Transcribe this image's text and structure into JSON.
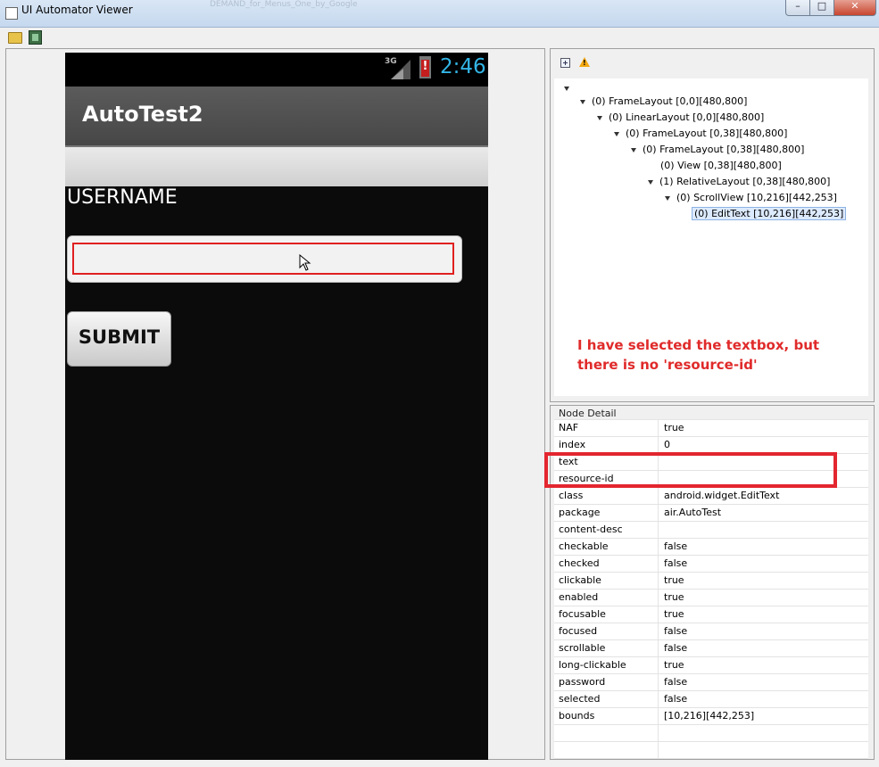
{
  "window": {
    "title": "UI Automator Viewer",
    "background_tab_text": "DEMAND_for_Menus_One_by_Google"
  },
  "toolbar": {
    "icons": [
      "folder-open-icon",
      "device-screenshot-icon"
    ]
  },
  "device": {
    "network_label": "3G",
    "battery_alert": "!",
    "clock": "2:46",
    "app_title": "AutoTest2",
    "username_label": "USERNAME",
    "submit_label": "SUBMIT"
  },
  "hierarchy": {
    "nodes": [
      {
        "label": "(0) FrameLayout [0,0][480,800]",
        "depth": 0
      },
      {
        "label": "(0) LinearLayout [0,0][480,800]",
        "depth": 1
      },
      {
        "label": "(0) FrameLayout [0,38][480,800]",
        "depth": 2
      },
      {
        "label": "(0) FrameLayout [0,38][480,800]",
        "depth": 3
      },
      {
        "label": "(0) View [0,38][480,800]",
        "depth": 4
      },
      {
        "label": "(1) RelativeLayout [0,38][480,800]",
        "depth": 4
      },
      {
        "label": "(0) ScrollView [10,216][442,253]",
        "depth": 5
      },
      {
        "label": "(0) EditText [10,216][442,253]",
        "depth": 6,
        "selected": true
      }
    ],
    "annotation": "I have selected the textbox, but there is no 'resource-id'"
  },
  "node_detail": {
    "title": "Node Detail",
    "rows": [
      {
        "key": "NAF",
        "value": "true"
      },
      {
        "key": "index",
        "value": "0"
      },
      {
        "key": "text",
        "value": ""
      },
      {
        "key": "resource-id",
        "value": ""
      },
      {
        "key": "class",
        "value": "android.widget.EditText"
      },
      {
        "key": "package",
        "value": "air.AutoTest"
      },
      {
        "key": "content-desc",
        "value": ""
      },
      {
        "key": "checkable",
        "value": "false"
      },
      {
        "key": "checked",
        "value": "false"
      },
      {
        "key": "clickable",
        "value": "true"
      },
      {
        "key": "enabled",
        "value": "true"
      },
      {
        "key": "focusable",
        "value": "true"
      },
      {
        "key": "focused",
        "value": "false"
      },
      {
        "key": "scrollable",
        "value": "false"
      },
      {
        "key": "long-clickable",
        "value": "true"
      },
      {
        "key": "password",
        "value": "false"
      },
      {
        "key": "selected",
        "value": "false"
      },
      {
        "key": "bounds",
        "value": "[10,216][442,253]"
      },
      {
        "key": "",
        "value": ""
      },
      {
        "key": "",
        "value": ""
      }
    ]
  },
  "colors": {
    "annotation_red": "#e02a2a",
    "highlight_red": "#e3262f",
    "clock_blue": "#33b5e5"
  }
}
